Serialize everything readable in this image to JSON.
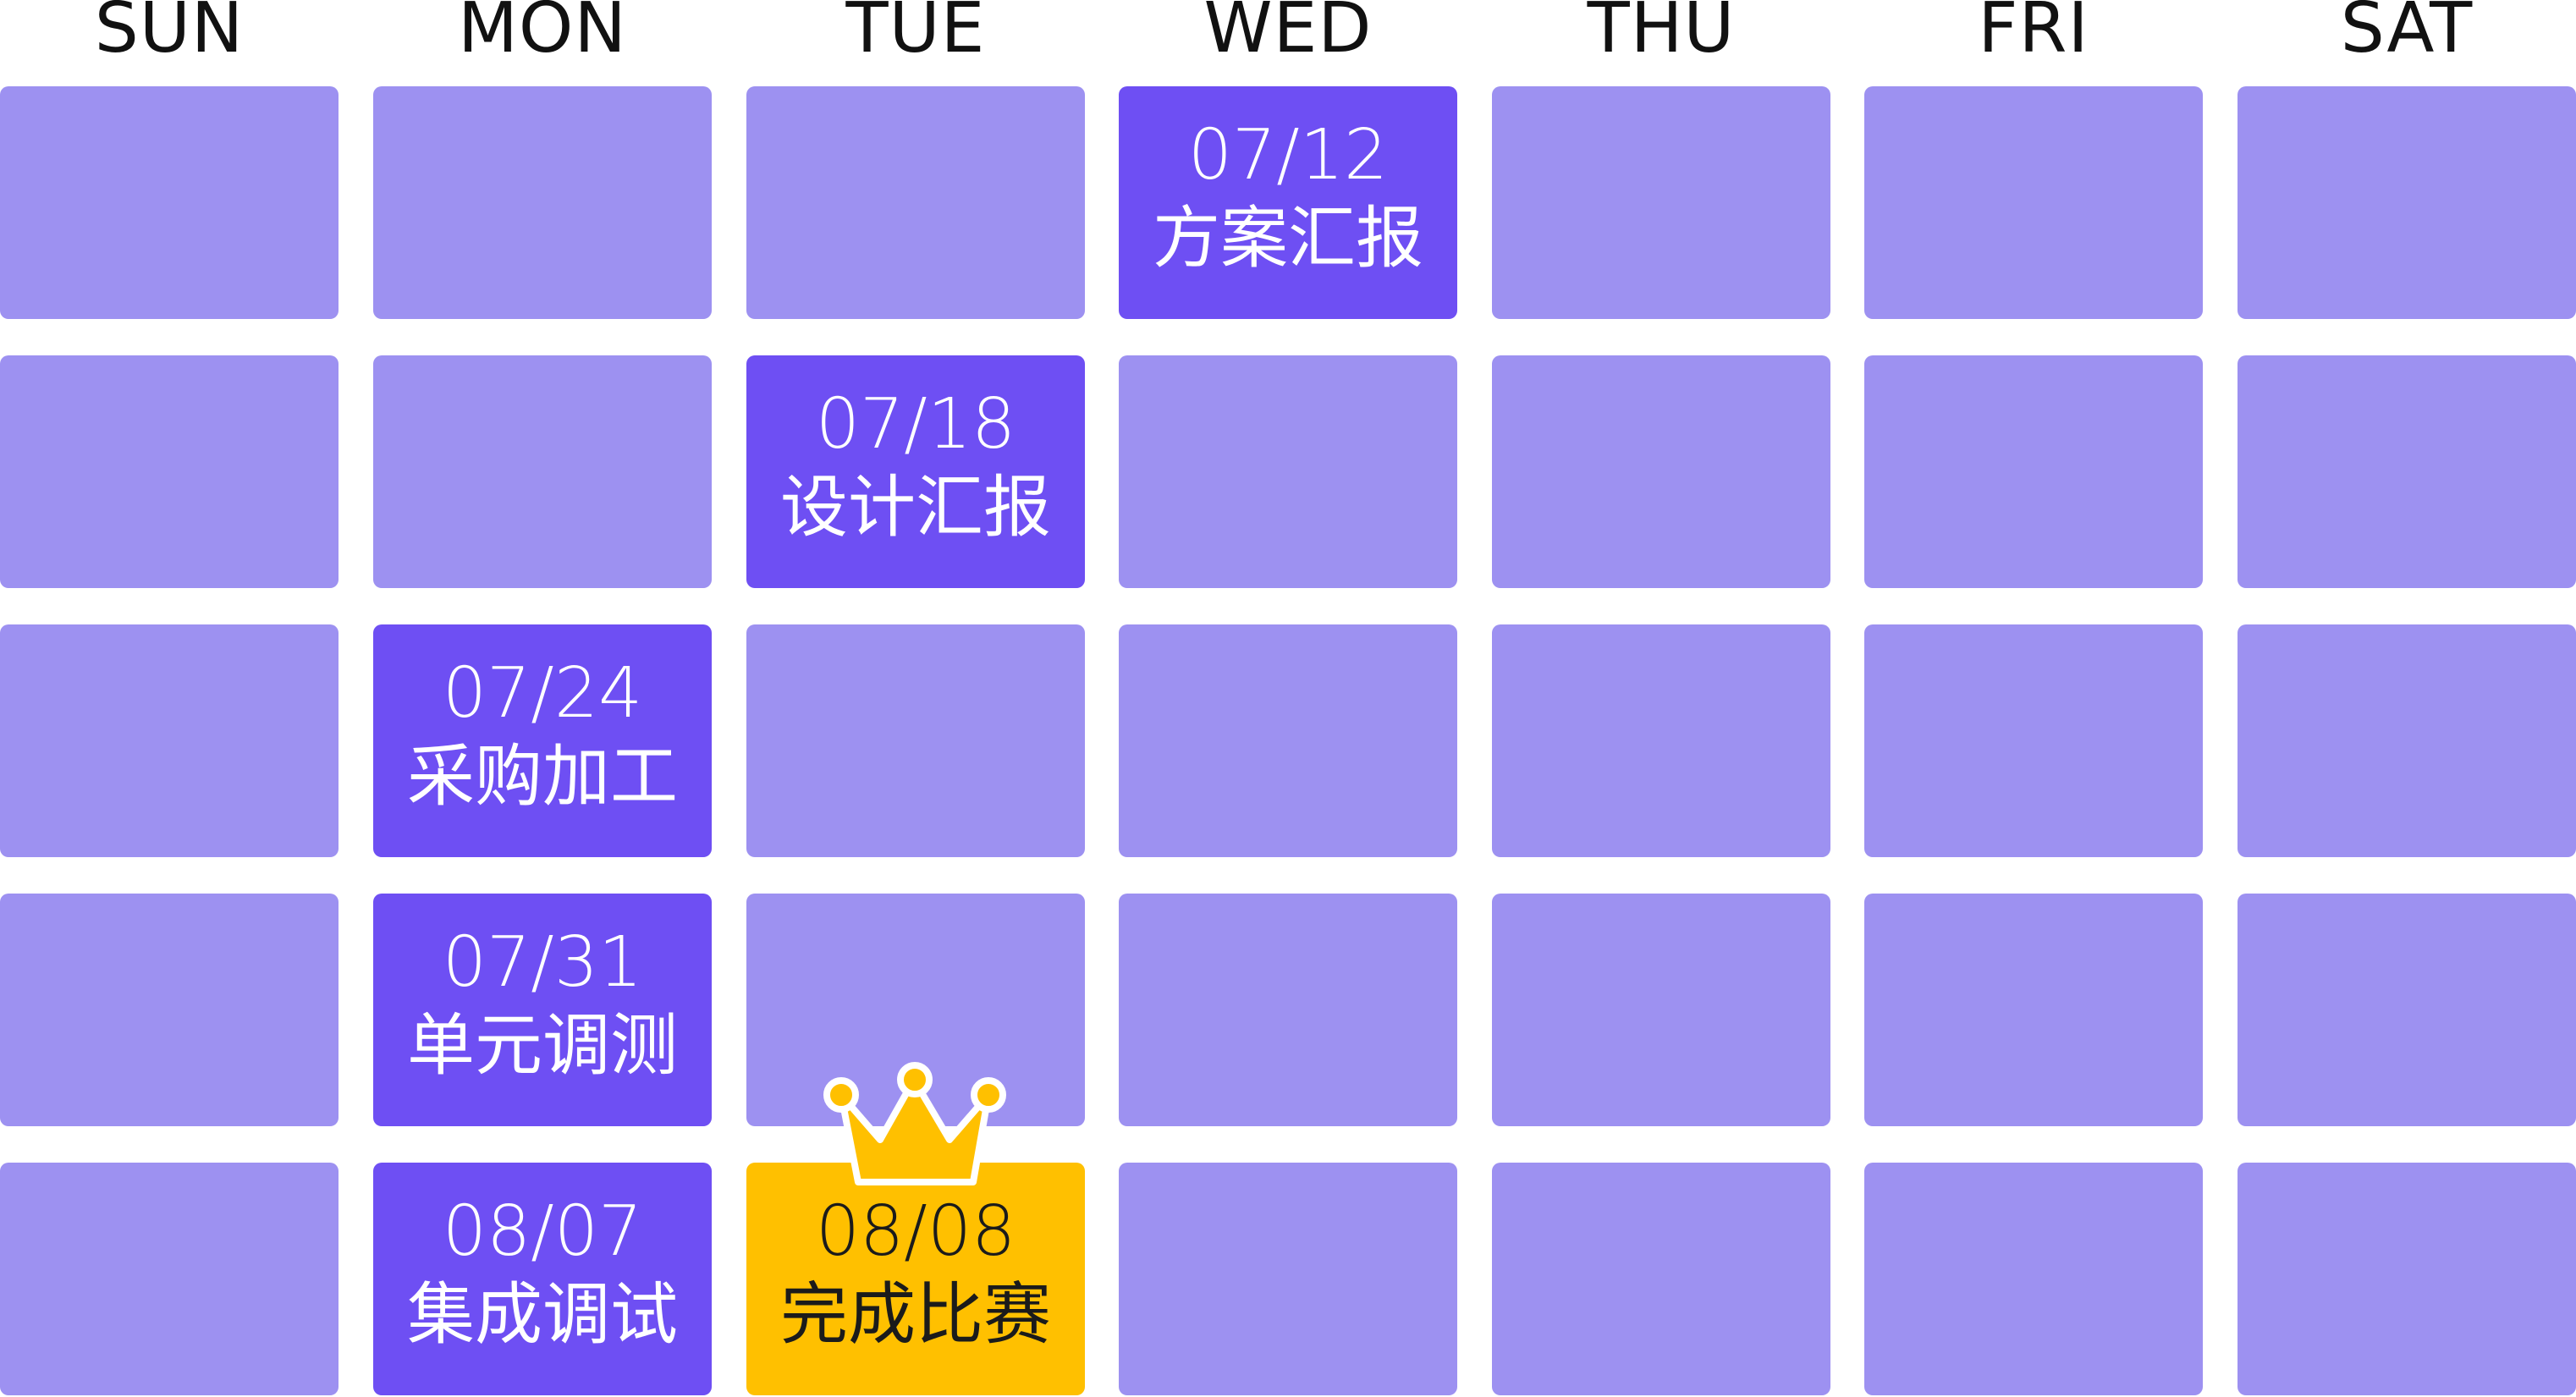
{
  "days": [
    "SUN",
    "MON",
    "TUE",
    "WED",
    "THU",
    "FRI",
    "SAT"
  ],
  "colors": {
    "cell": "#9d91f1",
    "event": "#6e4ff3",
    "final": "#ffc000",
    "header_text": "#111111"
  },
  "events": [
    {
      "date": "07/12",
      "label": "方案汇报"
    },
    {
      "date": "07/18",
      "label": "设计汇报"
    },
    {
      "date": "07/24",
      "label": "采购加工"
    },
    {
      "date": "07/31",
      "label": "单元调测"
    },
    {
      "date": "08/07",
      "label": "集成调试"
    },
    {
      "date": "08/08",
      "label": "完成比赛"
    }
  ],
  "final_icon": "crown-icon"
}
